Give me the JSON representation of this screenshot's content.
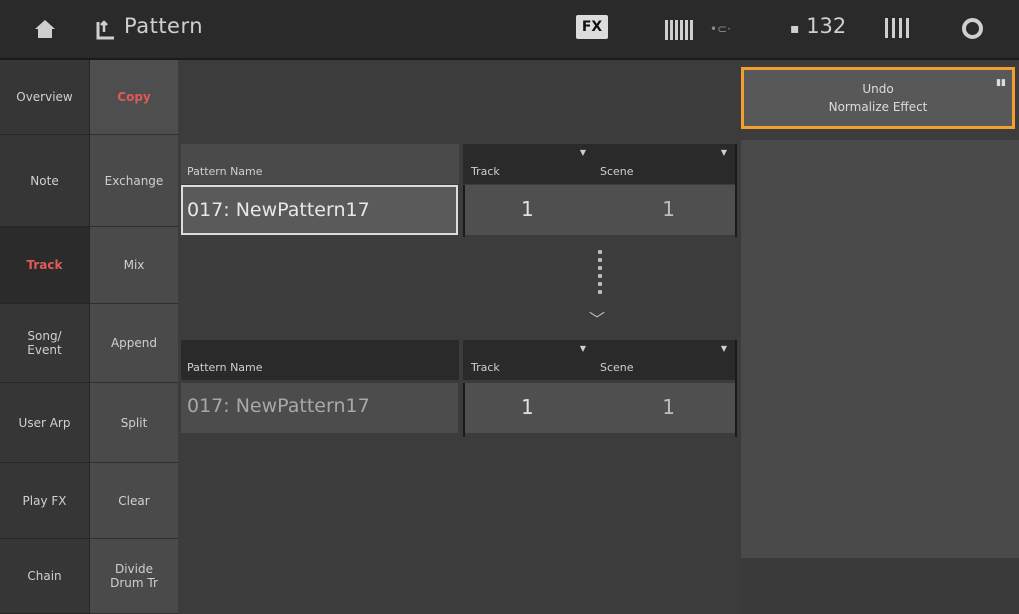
{
  "header": {
    "title": "Pattern",
    "fx_badge": "FX",
    "tempo": "132",
    "icons": [
      "home-icon",
      "pattern-icon",
      "usb-icon",
      "record-icon"
    ]
  },
  "nav_col1": [
    {
      "label": "Overview",
      "active": false
    },
    {
      "label": "Note",
      "active": false
    },
    {
      "label": "Track",
      "active": true
    },
    {
      "label": "Song/\nEvent",
      "active": false
    },
    {
      "label": "User Arp",
      "active": false
    },
    {
      "label": "Play FX",
      "active": false
    },
    {
      "label": "Chain",
      "active": false
    }
  ],
  "nav_col2": [
    {
      "label": "Copy",
      "active": true
    },
    {
      "label": "Exchange",
      "active": false
    },
    {
      "label": "Mix",
      "active": false
    },
    {
      "label": "Append",
      "active": false
    },
    {
      "label": "Split",
      "active": false
    },
    {
      "label": "Clear",
      "active": false
    },
    {
      "label": "Divide\nDrum Tr",
      "active": false
    }
  ],
  "undo_button": {
    "line1": "Undo",
    "line2": "Normalize Effect"
  },
  "source": {
    "pattern_name_header": "Pattern Name",
    "track_header": "Track",
    "scene_header": "Scene",
    "pattern_name": "017: NewPattern17",
    "track": "1",
    "scene": "1"
  },
  "destination": {
    "pattern_name_header": "Pattern Name",
    "track_header": "Track",
    "scene_header": "Scene",
    "pattern_name": "017: NewPattern17",
    "track": "1",
    "scene": "1"
  },
  "colors": {
    "accent_active": "#e05a5a",
    "highlight": "#f0a030"
  }
}
